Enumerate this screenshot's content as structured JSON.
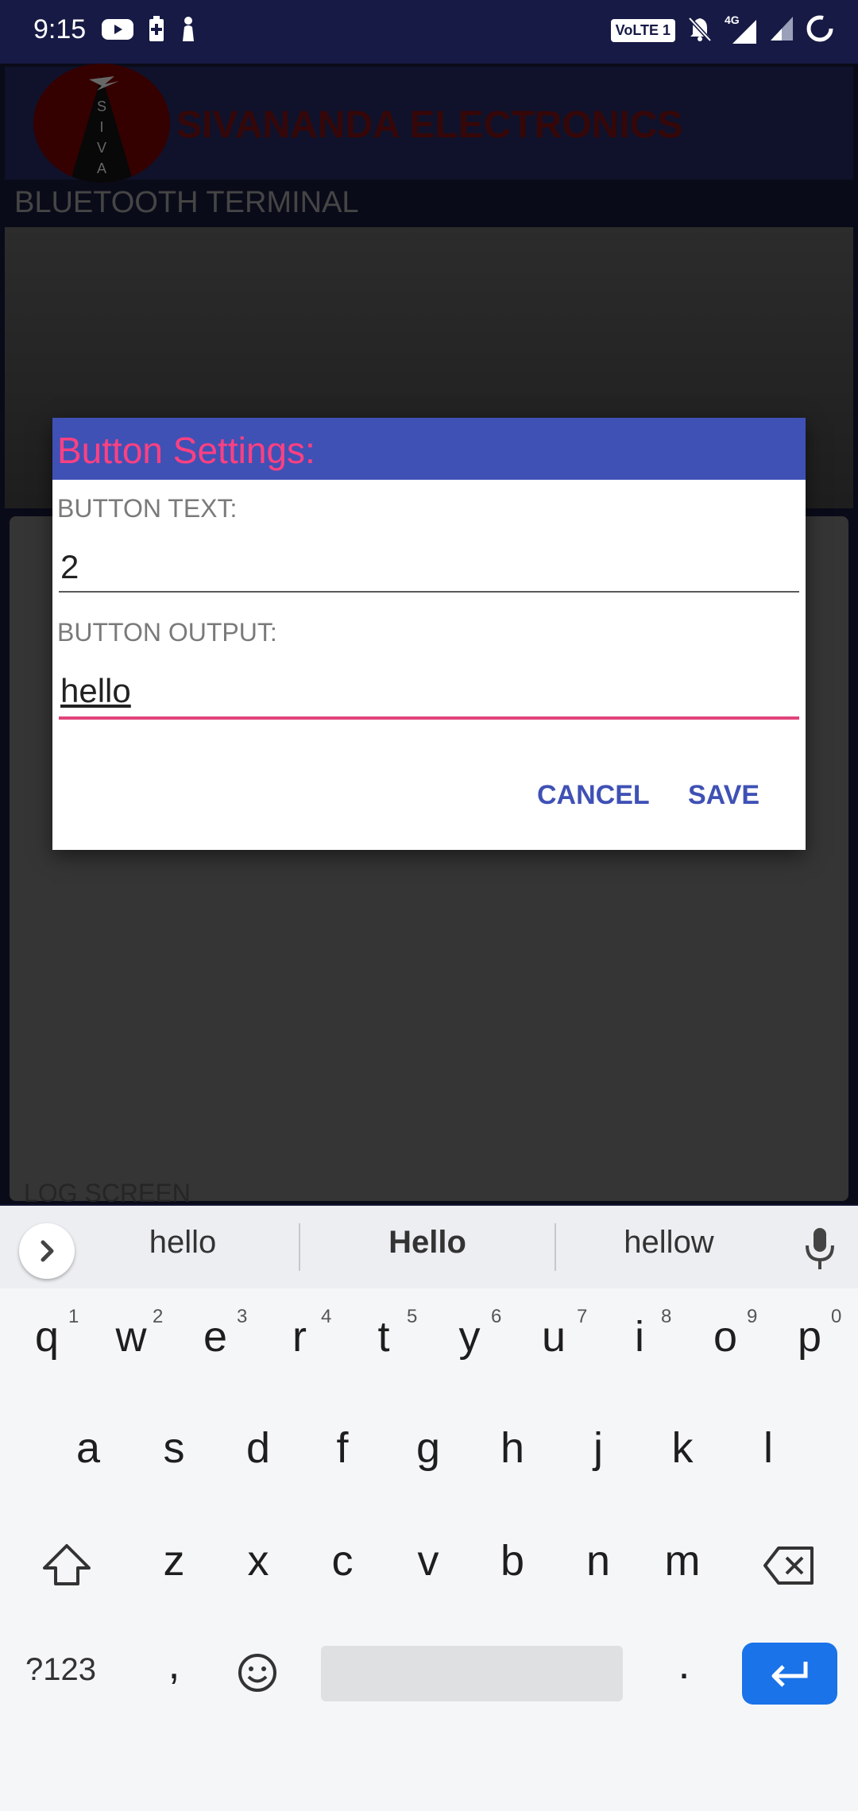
{
  "status_bar": {
    "time": "9:15",
    "icons_left": [
      "youtube-icon",
      "battery-saver-icon",
      "notification-icon"
    ],
    "icons_right": [
      "volte-icon",
      "bell-off-icon",
      "signal-4g-icon",
      "signal-icon",
      "loading-icon"
    ],
    "volte_label": "VoLTE 1",
    "network_label": "4G"
  },
  "app": {
    "logo_letters": "SIVA",
    "brand": "SIVANANDA ELECTRONICS",
    "bt_label": "BLUETOOTH TERMINAL",
    "log_label": "LOG SCREEN"
  },
  "dialog": {
    "title": "Button Settings:",
    "button_text_label": "BUTTON TEXT:",
    "button_text_value": "2",
    "button_output_label": "BUTTON OUTPUT:",
    "button_output_value": "hello",
    "cancel_label": "CANCEL",
    "save_label": "SAVE",
    "accent_color": "#3f51b5",
    "title_color": "#ff4081"
  },
  "keyboard": {
    "suggestions": [
      "hello",
      "Hello",
      "hellow"
    ],
    "row1": [
      "q",
      "w",
      "e",
      "r",
      "t",
      "y",
      "u",
      "i",
      "o",
      "p"
    ],
    "row1_hints": [
      "1",
      "2",
      "3",
      "4",
      "5",
      "6",
      "7",
      "8",
      "9",
      "0"
    ],
    "row2": [
      "a",
      "s",
      "d",
      "f",
      "g",
      "h",
      "j",
      "k",
      "l"
    ],
    "row3": [
      "z",
      "x",
      "c",
      "v",
      "b",
      "n",
      "m"
    ],
    "symbols_label": "?123",
    "comma_label": ",",
    "period_label": ".",
    "enter_color": "#1a73e8"
  }
}
